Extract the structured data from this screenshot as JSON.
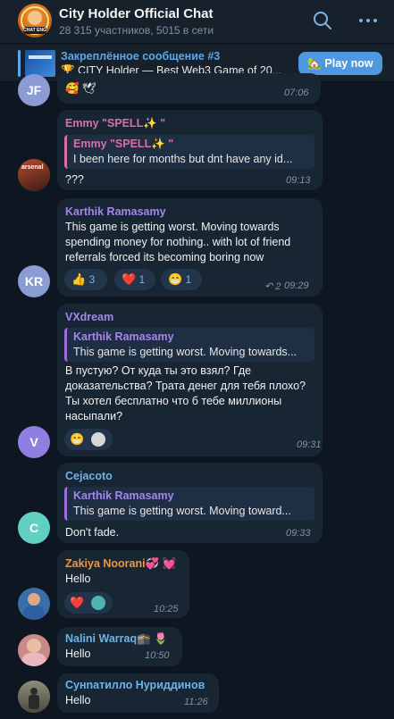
{
  "header": {
    "title": "City Holder Official Chat",
    "subtitle": "28 315 участников, 5015 в сети",
    "avatar_badge": "CHAT ENG"
  },
  "pinned": {
    "title": "Закреплённое сообщение #3",
    "text": "🏆 CITY Holder — Best Web3 Game of 20...",
    "button": "🏡 Play now"
  },
  "messages": [
    {
      "avatar_initials": "JF",
      "avatar_color": "#8b9bd3",
      "time": "07:06",
      "emojis": "🥰 🕊"
    },
    {
      "sender": "Emmy \"SPELL✨ \"",
      "sender_color": "#d86fa4",
      "quote_name": "Emmy \"SPELL✨ \"",
      "quote_text": "I been here for months but dnt have any id...",
      "text": "???",
      "time": "09:13"
    },
    {
      "avatar_initials": "KR",
      "avatar_color": "#8b9bd3",
      "sender": "Karthik Ramasamy",
      "sender_color": "#a286e8",
      "lines": [
        "This game is getting worst. Moving towards",
        "spending money for nothing.. with lot of friend",
        "referrals forced its becoming boring now"
      ],
      "reactions": [
        {
          "emoji": "👍",
          "count": "3"
        },
        {
          "emoji": "❤️",
          "count": "1"
        },
        {
          "emoji": "😁",
          "count": "1"
        }
      ],
      "reply_count": "2",
      "time": "09:29"
    },
    {
      "avatar_initials": "V",
      "avatar_color": "#8f7fe0",
      "sender": "VXdream",
      "sender_color": "#a286e8",
      "quote_name": "Karthik Ramasamy",
      "quote_text": "This game is getting worst. Moving towards...",
      "lines": [
        "В пустую? От куда ты это взял? Где",
        "доказательства? Трата денег для тебя плохо?",
        "Ты хотел бесплатно что б тебе миллионы",
        "насыпали?"
      ],
      "time": "09:31"
    },
    {
      "avatar_initials": "C",
      "avatar_color": "#5fd0c2",
      "sender": "Cejacoto",
      "sender_color": "#6fb3e6",
      "quote_name": "Karthik Ramasamy",
      "quote_text": "This game is getting worst. Moving toward...",
      "text": "Don't fade.",
      "time": "09:33"
    },
    {
      "sender": "Zakiya Noorani💞 💓",
      "sender_color": "#e39a4a",
      "text": "Hello",
      "time": "10:25"
    },
    {
      "sender": "Nalini Warraq🕋 🌷",
      "sender_color": "#6fb3e6",
      "text": "Hello",
      "time": "10:50"
    },
    {
      "sender": "Сунnатилло Нуриддинов",
      "sender_color": "#6fb3e6",
      "text": "Hello",
      "time": "11:26"
    }
  ]
}
